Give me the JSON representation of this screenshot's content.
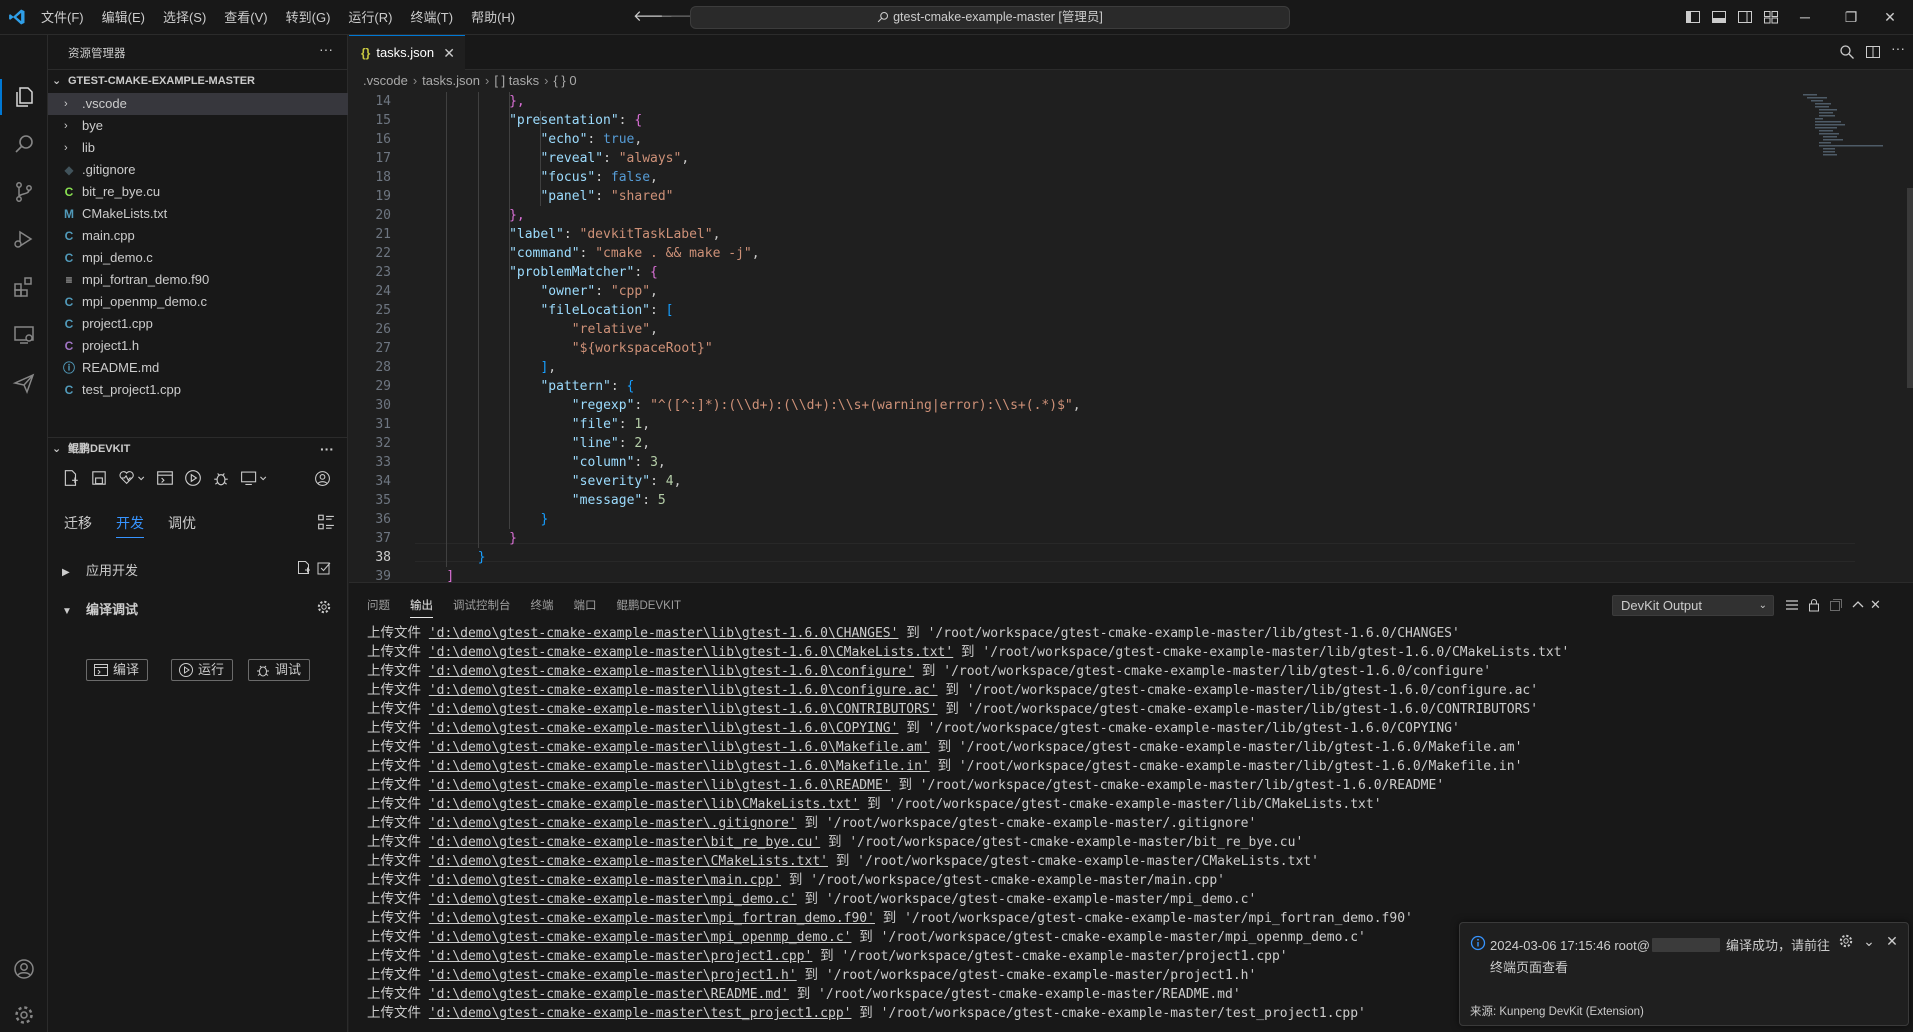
{
  "titlebar": {
    "menus": [
      "文件(F)",
      "编辑(E)",
      "选择(S)",
      "查看(V)",
      "转到(G)",
      "运行(R)",
      "终端(T)",
      "帮助(H)"
    ],
    "command_center": "gtest-cmake-example-master [管理员]"
  },
  "sidebar": {
    "title": "资源管理器",
    "folder": "GTEST-CMAKE-EXAMPLE-MASTER",
    "items": [
      {
        "name": ".vscode",
        "type": "folder",
        "icon": "chevron-right-icon",
        "active": true
      },
      {
        "name": "bye",
        "type": "folder",
        "icon": "chevron-right-icon"
      },
      {
        "name": "lib",
        "type": "folder",
        "icon": "chevron-right-icon"
      },
      {
        "name": ".gitignore",
        "type": "file",
        "icon": "gitignore-icon",
        "glyph": "◆",
        "color": "#41535b"
      },
      {
        "name": "bit_re_bye.cu",
        "type": "file",
        "icon": "cuda-icon",
        "glyph": "C",
        "color": "#89e051"
      },
      {
        "name": "CMakeLists.txt",
        "type": "file",
        "icon": "cmake-icon",
        "glyph": "M",
        "color": "#519aba"
      },
      {
        "name": "main.cpp",
        "type": "file",
        "icon": "cpp-icon",
        "glyph": "C",
        "color": "#519aba"
      },
      {
        "name": "mpi_demo.c",
        "type": "file",
        "icon": "c-icon",
        "glyph": "C",
        "color": "#519aba"
      },
      {
        "name": "mpi_fortran_demo.f90",
        "type": "file",
        "icon": "fortran-icon",
        "glyph": "≡",
        "color": "#cccccc"
      },
      {
        "name": "mpi_openmp_demo.c",
        "type": "file",
        "icon": "c-icon",
        "glyph": "C",
        "color": "#519aba"
      },
      {
        "name": "project1.cpp",
        "type": "file",
        "icon": "cpp-icon",
        "glyph": "C",
        "color": "#519aba"
      },
      {
        "name": "project1.h",
        "type": "file",
        "icon": "header-icon",
        "glyph": "C",
        "color": "#a074c4"
      },
      {
        "name": "README.md",
        "type": "file",
        "icon": "info-icon",
        "glyph": "ⓘ",
        "color": "#519aba"
      },
      {
        "name": "test_project1.cpp",
        "type": "file",
        "icon": "cpp-icon",
        "glyph": "C",
        "color": "#519aba"
      }
    ],
    "devkit": {
      "title": "鲲鹏DEVKIT",
      "tabs": [
        "迁移",
        "开发",
        "调优"
      ],
      "selected_tab": 1,
      "section_app": "应用开发",
      "section_build": "编译调试",
      "buttons": {
        "compile": "编译",
        "run": "运行",
        "debug": "调试"
      }
    }
  },
  "editor": {
    "tab": "tasks.json",
    "tab_icon": "{}",
    "breadcrumb": [
      ".vscode",
      "tasks.json",
      "[ ] tasks",
      "{ } 0"
    ],
    "current_line": 38,
    "lines": [
      {
        "n": "14",
        "i": 3,
        "t": [
          [
            "p2",
            "},"
          ]
        ]
      },
      {
        "n": "15",
        "i": 3,
        "t": [
          [
            "k",
            "\"presentation\""
          ],
          [
            "pu",
            ": "
          ],
          [
            "p2",
            "{"
          ]
        ]
      },
      {
        "n": "16",
        "i": 4,
        "t": [
          [
            "k",
            "\"echo\""
          ],
          [
            "pu",
            ": "
          ],
          [
            "b",
            "true"
          ],
          [
            "pu",
            ","
          ]
        ]
      },
      {
        "n": "17",
        "i": 4,
        "t": [
          [
            "k",
            "\"reveal\""
          ],
          [
            "pu",
            ": "
          ],
          [
            "s",
            "\"always\""
          ],
          [
            "pu",
            ","
          ]
        ]
      },
      {
        "n": "18",
        "i": 4,
        "t": [
          [
            "k",
            "\"focus\""
          ],
          [
            "pu",
            ": "
          ],
          [
            "b",
            "false"
          ],
          [
            "pu",
            ","
          ]
        ]
      },
      {
        "n": "19",
        "i": 4,
        "t": [
          [
            "k",
            "\"panel\""
          ],
          [
            "pu",
            ": "
          ],
          [
            "s",
            "\"shared\""
          ]
        ]
      },
      {
        "n": "20",
        "i": 3,
        "t": [
          [
            "p2",
            "},"
          ]
        ]
      },
      {
        "n": "21",
        "i": 3,
        "t": [
          [
            "k",
            "\"label\""
          ],
          [
            "pu",
            ": "
          ],
          [
            "s",
            "\"devkitTaskLabel\""
          ],
          [
            "pu",
            ","
          ]
        ]
      },
      {
        "n": "22",
        "i": 3,
        "t": [
          [
            "k",
            "\"command\""
          ],
          [
            "pu",
            ": "
          ],
          [
            "s",
            "\"cmake . && make -j\""
          ],
          [
            "pu",
            ","
          ]
        ]
      },
      {
        "n": "23",
        "i": 3,
        "t": [
          [
            "k",
            "\"problemMatcher\""
          ],
          [
            "pu",
            ": "
          ],
          [
            "p2",
            "{"
          ]
        ]
      },
      {
        "n": "24",
        "i": 4,
        "t": [
          [
            "k",
            "\"owner\""
          ],
          [
            "pu",
            ": "
          ],
          [
            "s",
            "\"cpp\""
          ],
          [
            "pu",
            ","
          ]
        ]
      },
      {
        "n": "25",
        "i": 4,
        "t": [
          [
            "k",
            "\"fileLocation\""
          ],
          [
            "pu",
            ": "
          ],
          [
            "p3",
            "["
          ]
        ]
      },
      {
        "n": "26",
        "i": 5,
        "t": [
          [
            "s",
            "\"relative\""
          ],
          [
            "pu",
            ","
          ]
        ]
      },
      {
        "n": "27",
        "i": 5,
        "t": [
          [
            "s",
            "\"${workspaceRoot}\""
          ]
        ]
      },
      {
        "n": "28",
        "i": 4,
        "t": [
          [
            "p3",
            "]"
          ],
          [
            "pu",
            ","
          ]
        ]
      },
      {
        "n": "29",
        "i": 4,
        "t": [
          [
            "k",
            "\"pattern\""
          ],
          [
            "pu",
            ": "
          ],
          [
            "p3",
            "{"
          ]
        ]
      },
      {
        "n": "30",
        "i": 5,
        "t": [
          [
            "k",
            "\"regexp\""
          ],
          [
            "pu",
            ": "
          ],
          [
            "s",
            "\"^([^:]*):(\\\\d+):(\\\\d+):\\\\s+(warning|error):\\\\s+(.*)$\""
          ],
          [
            "pu",
            ","
          ]
        ]
      },
      {
        "n": "31",
        "i": 5,
        "t": [
          [
            "k",
            "\"file\""
          ],
          [
            "pu",
            ": "
          ],
          [
            "n",
            "1"
          ],
          [
            "pu",
            ","
          ]
        ]
      },
      {
        "n": "32",
        "i": 5,
        "t": [
          [
            "k",
            "\"line\""
          ],
          [
            "pu",
            ": "
          ],
          [
            "n",
            "2"
          ],
          [
            "pu",
            ","
          ]
        ]
      },
      {
        "n": "33",
        "i": 5,
        "t": [
          [
            "k",
            "\"column\""
          ],
          [
            "pu",
            ": "
          ],
          [
            "n",
            "3"
          ],
          [
            "pu",
            ","
          ]
        ]
      },
      {
        "n": "34",
        "i": 5,
        "t": [
          [
            "k",
            "\"severity\""
          ],
          [
            "pu",
            ": "
          ],
          [
            "n",
            "4"
          ],
          [
            "pu",
            ","
          ]
        ]
      },
      {
        "n": "35",
        "i": 5,
        "t": [
          [
            "k",
            "\"message\""
          ],
          [
            "pu",
            ": "
          ],
          [
            "n",
            "5"
          ]
        ]
      },
      {
        "n": "36",
        "i": 4,
        "t": [
          [
            "p3",
            "}"
          ]
        ]
      },
      {
        "n": "37",
        "i": 3,
        "t": [
          [
            "p2",
            "}"
          ]
        ]
      },
      {
        "n": "38",
        "i": 2,
        "t": [
          [
            "p3",
            "}"
          ]
        ]
      },
      {
        "n": "39",
        "i": 1,
        "t": [
          [
            "p2",
            "]"
          ]
        ]
      }
    ]
  },
  "panel": {
    "tabs": [
      "问题",
      "输出",
      "调试控制台",
      "终端",
      "端口",
      "鲲鹏DEVKIT"
    ],
    "selected_tab": 1,
    "output_channel": "DevKit Output",
    "upload_label": "上传文件",
    "to_label": "到",
    "lines": [
      [
        "'d:\\demo\\gtest-cmake-example-master\\lib\\gtest-1.6.0\\CHANGES'",
        "'/root/workspace/gtest-cmake-example-master/lib/gtest-1.6.0/CHANGES'"
      ],
      [
        "'d:\\demo\\gtest-cmake-example-master\\lib\\gtest-1.6.0\\CMakeLists.txt'",
        "'/root/workspace/gtest-cmake-example-master/lib/gtest-1.6.0/CMakeLists.txt'"
      ],
      [
        "'d:\\demo\\gtest-cmake-example-master\\lib\\gtest-1.6.0\\configure'",
        "'/root/workspace/gtest-cmake-example-master/lib/gtest-1.6.0/configure'"
      ],
      [
        "'d:\\demo\\gtest-cmake-example-master\\lib\\gtest-1.6.0\\configure.ac'",
        "'/root/workspace/gtest-cmake-example-master/lib/gtest-1.6.0/configure.ac'"
      ],
      [
        "'d:\\demo\\gtest-cmake-example-master\\lib\\gtest-1.6.0\\CONTRIBUTORS'",
        "'/root/workspace/gtest-cmake-example-master/lib/gtest-1.6.0/CONTRIBUTORS'"
      ],
      [
        "'d:\\demo\\gtest-cmake-example-master\\lib\\gtest-1.6.0\\COPYING'",
        "'/root/workspace/gtest-cmake-example-master/lib/gtest-1.6.0/COPYING'"
      ],
      [
        "'d:\\demo\\gtest-cmake-example-master\\lib\\gtest-1.6.0\\Makefile.am'",
        "'/root/workspace/gtest-cmake-example-master/lib/gtest-1.6.0/Makefile.am'"
      ],
      [
        "'d:\\demo\\gtest-cmake-example-master\\lib\\gtest-1.6.0\\Makefile.in'",
        "'/root/workspace/gtest-cmake-example-master/lib/gtest-1.6.0/Makefile.in'"
      ],
      [
        "'d:\\demo\\gtest-cmake-example-master\\lib\\gtest-1.6.0\\README'",
        "'/root/workspace/gtest-cmake-example-master/lib/gtest-1.6.0/README'"
      ],
      [
        "'d:\\demo\\gtest-cmake-example-master\\lib\\CMakeLists.txt'",
        "'/root/workspace/gtest-cmake-example-master/lib/CMakeLists.txt'"
      ],
      [
        "'d:\\demo\\gtest-cmake-example-master\\.gitignore'",
        "'/root/workspace/gtest-cmake-example-master/.gitignore'"
      ],
      [
        "'d:\\demo\\gtest-cmake-example-master\\bit_re_bye.cu'",
        "'/root/workspace/gtest-cmake-example-master/bit_re_bye.cu'"
      ],
      [
        "'d:\\demo\\gtest-cmake-example-master\\CMakeLists.txt'",
        "'/root/workspace/gtest-cmake-example-master/CMakeLists.txt'"
      ],
      [
        "'d:\\demo\\gtest-cmake-example-master\\main.cpp'",
        "'/root/workspace/gtest-cmake-example-master/main.cpp'"
      ],
      [
        "'d:\\demo\\gtest-cmake-example-master\\mpi_demo.c'",
        "'/root/workspace/gtest-cmake-example-master/mpi_demo.c'"
      ],
      [
        "'d:\\demo\\gtest-cmake-example-master\\mpi_fortran_demo.f90'",
        "'/root/workspace/gtest-cmake-example-master/mpi_fortran_demo.f90'"
      ],
      [
        "'d:\\demo\\gtest-cmake-example-master\\mpi_openmp_demo.c'",
        "'/root/workspace/gtest-cmake-example-master/mpi_openmp_demo.c'"
      ],
      [
        "'d:\\demo\\gtest-cmake-example-master\\project1.cpp'",
        "'/root/workspace/gtest-cmake-example-master/project1.cpp'"
      ],
      [
        "'d:\\demo\\gtest-cmake-example-master\\project1.h'",
        "'/root/workspace/gtest-cmake-example-master/project1.h'"
      ],
      [
        "'d:\\demo\\gtest-cmake-example-master\\README.md'",
        "'/root/workspace/gtest-cmake-example-master/README.md'"
      ],
      [
        "'d:\\demo\\gtest-cmake-example-master\\test_project1.cpp'",
        "'/root/workspace/gtest-cmake-example-master/test_project1.cpp'"
      ]
    ]
  },
  "notification": {
    "message_prefix": "2024-03-06 17:15:46 root@",
    "message_suffix": "编译成功，请前往",
    "message_line2": "终端页面查看",
    "source": "来源: Kunpeng DevKit (Extension)"
  },
  "colors": {
    "accent": "#0078d4",
    "link": "#3794ff",
    "bg": "#1f1f1f",
    "chrome": "#181818"
  }
}
